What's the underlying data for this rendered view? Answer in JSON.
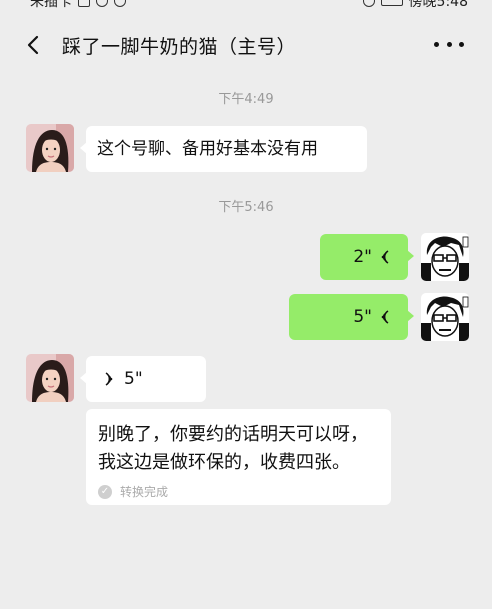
{
  "status_bar": {
    "carrier": "未插卡",
    "time": "傍晚5:48"
  },
  "header": {
    "title": "踩了一脚牛奶的猫（主号）"
  },
  "messages": {
    "ts1": "下午4:49",
    "m1_text": "这个号聊、备用好基本没有用",
    "ts2": "下午5:46",
    "m2_duration": "2\"",
    "m3_duration": "5\"",
    "m4_duration": "5\"",
    "m4_transcript": "别晚了，你要约的话明天可以呀，我这边是做环保的，收费四张。",
    "m4_transcript_status": "转换完成"
  },
  "colors": {
    "background": "#ededed",
    "self_bubble": "#95ec69",
    "other_bubble": "#ffffff"
  }
}
